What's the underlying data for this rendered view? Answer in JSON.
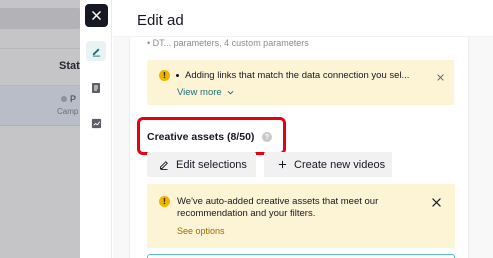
{
  "background": {
    "column_header": "Stat",
    "row": {
      "status_short": "P",
      "secondary_short": "Camp"
    }
  },
  "drawer": {
    "title": "Edit ad",
    "rail_icons": [
      "edit-icon",
      "document-icon",
      "analytics-icon"
    ],
    "clipped_text": "• DT... parameters, 4 custom parameters",
    "banner_top": {
      "message": "Adding links that match the data connection you sel...",
      "link": "View more"
    },
    "creative_assets": {
      "title": "Creative assets (8/50)"
    },
    "buttons": {
      "edit": "Edit selections",
      "create": "Create new videos"
    },
    "banner_bottom": {
      "line1": "We've auto-added creative assets that meet our",
      "line2": "recommendation and your filters.",
      "link": "See options"
    }
  },
  "colors": {
    "warning_bg": "#fdf4d6",
    "warning_icon": "#f0b400",
    "link_teal": "#1f6f7a",
    "highlight_red": "#e60012"
  }
}
